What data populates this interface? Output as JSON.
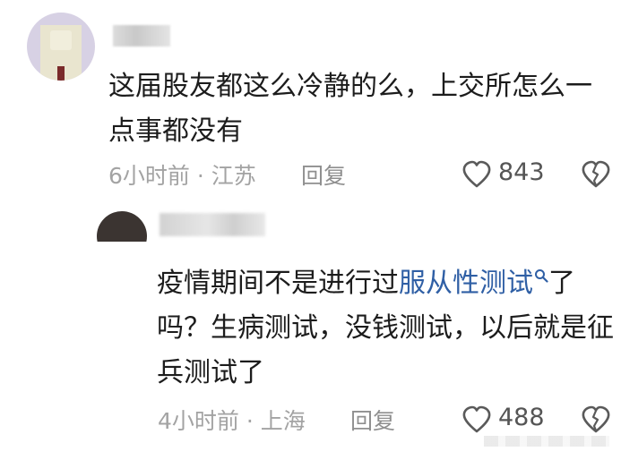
{
  "comment": {
    "text": "这届股友都这么冷静的么，上交所怎么一点事都没有",
    "meta": "6小时前 · 江苏",
    "reply_label": "回复",
    "like_count": "843",
    "like_icon": "heart-outline-icon",
    "dislike_icon": "broken-heart-icon"
  },
  "reply": {
    "text_before": "疫情期间不是进行过",
    "link_text": "服从性测试",
    "text_after": "了吗？生病测试，没钱测试，以后就是征兵测试了",
    "meta": "4小时前 · 上海",
    "reply_label": "回复",
    "like_count": "488",
    "like_icon": "heart-outline-icon",
    "dislike_icon": "broken-heart-icon",
    "link_icon": "search-icon"
  },
  "colors": {
    "link": "#2f5fa5",
    "meta": "#a3a3a3",
    "text": "#1c1c1c"
  }
}
